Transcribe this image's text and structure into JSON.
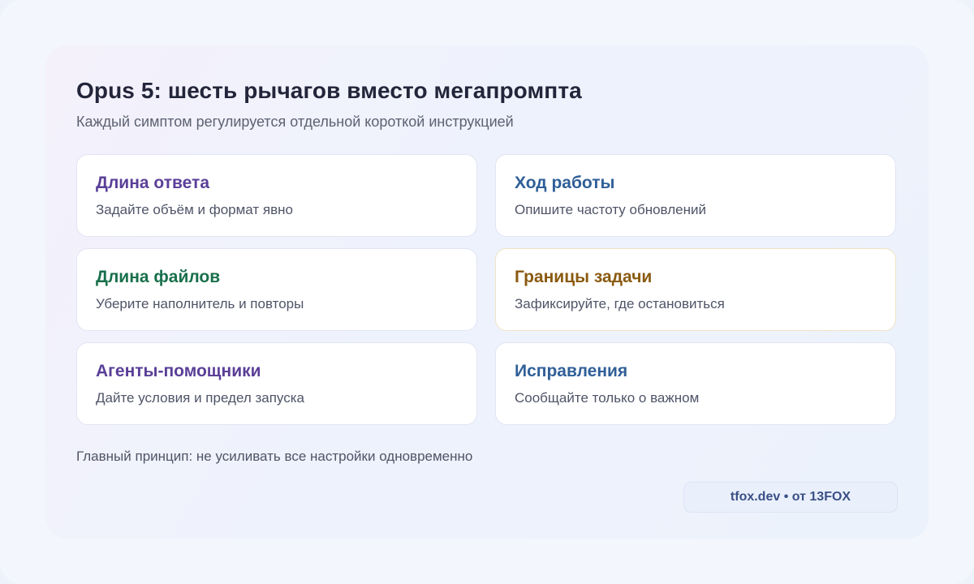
{
  "header": {
    "title": "Opus 5: шесть рычагов вместо мегапромпта",
    "subtitle": "Каждый симптом регулируется отдельной короткой инструкцией"
  },
  "cards": [
    {
      "title": "Длина ответа",
      "desc": "Задайте объём и формат явно",
      "accent": "#5a3f98"
    },
    {
      "title": "Ход работы",
      "desc": "Опишите частоту обновлений",
      "accent": "#305f98"
    },
    {
      "title": "Длина файлов",
      "desc": "Уберите наполнитель и повторы",
      "accent": "#18704b"
    },
    {
      "title": "Границы задачи",
      "desc": "Зафиксируйте, где остановиться",
      "accent": "#8a5a10"
    },
    {
      "title": "Агенты-помощники",
      "desc": "Дайте условия и предел запуска",
      "accent": "#5a3f98"
    },
    {
      "title": "Исправления",
      "desc": "Сообщайте только о важном",
      "accent": "#305f98"
    }
  ],
  "footer": {
    "principle": "Главный принцип: не усиливать все настройки одновременно",
    "credit": "tfox.dev • от 13FOX"
  }
}
